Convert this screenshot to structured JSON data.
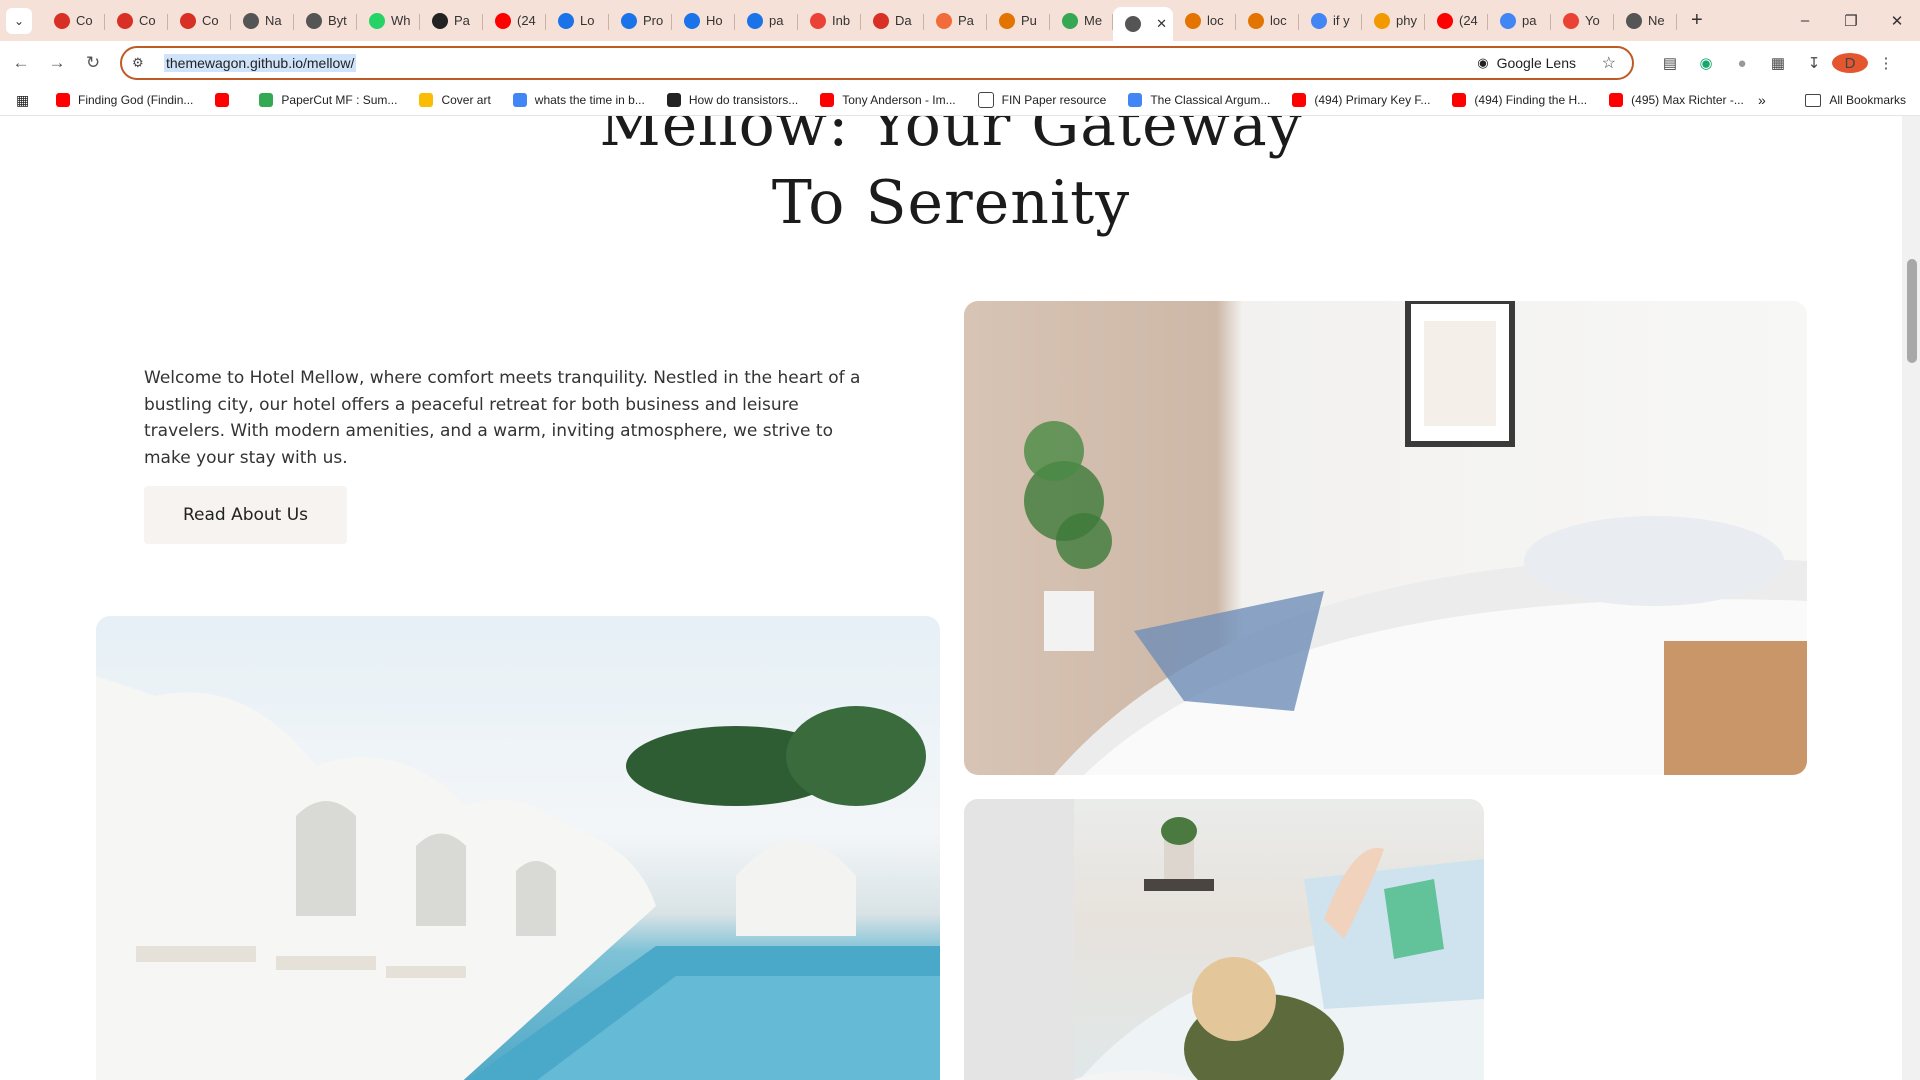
{
  "browser": {
    "tabs": [
      {
        "label": "Co",
        "icon": "loading-ring-icon",
        "color": "#d93025"
      },
      {
        "label": "Co",
        "icon": "loading-ring-icon",
        "color": "#d93025"
      },
      {
        "label": "Co",
        "icon": "loading-ring-icon",
        "color": "#d93025"
      },
      {
        "label": "Na",
        "icon": "globe-icon",
        "color": "#555555"
      },
      {
        "label": "Byt",
        "icon": "globe-icon",
        "color": "#555555"
      },
      {
        "label": "Wh",
        "icon": "whatsapp-icon",
        "color": "#25d366"
      },
      {
        "label": "Pa",
        "icon": "github-icon",
        "color": "#222222"
      },
      {
        "label": "(24",
        "icon": "youtube-icon",
        "color": "#ff0000"
      },
      {
        "label": "Lo",
        "icon": "docs-icon",
        "color": "#1a73e8"
      },
      {
        "label": "Pro",
        "icon": "docs-icon",
        "color": "#1a73e8"
      },
      {
        "label": "Ho",
        "icon": "docs-icon",
        "color": "#1a73e8"
      },
      {
        "label": "pa",
        "icon": "docs-icon",
        "color": "#1a73e8"
      },
      {
        "label": "Inb",
        "icon": "gmail-icon",
        "color": "#ea4335"
      },
      {
        "label": "Da",
        "icon": "loading-ring-icon",
        "color": "#d93025"
      },
      {
        "label": "Pa",
        "icon": "pay-icon",
        "color": "#f26b3a"
      },
      {
        "label": "Pu",
        "icon": "pub-icon",
        "color": "#e37400"
      },
      {
        "label": "Me",
        "icon": "leaf-icon",
        "color": "#34a853"
      },
      {
        "label": "",
        "icon": "globe-icon",
        "color": "#555555",
        "active": true
      },
      {
        "label": "loc",
        "icon": "chart-icon",
        "color": "#e37400"
      },
      {
        "label": "loc",
        "icon": "chart-icon",
        "color": "#e37400"
      },
      {
        "label": "if y",
        "icon": "google-icon",
        "color": "#4285f4"
      },
      {
        "label": "phy",
        "icon": "sheet-icon",
        "color": "#f29900"
      },
      {
        "label": "(24",
        "icon": "youtube-icon",
        "color": "#ff0000"
      },
      {
        "label": "pa",
        "icon": "google-icon",
        "color": "#4285f4"
      },
      {
        "label": "Yo",
        "icon": "gmail-icon",
        "color": "#ea4335"
      },
      {
        "label": "Ne",
        "icon": "globe-icon",
        "color": "#555555"
      }
    ],
    "url": "themewagon.github.io/mellow/",
    "google_lens_label": "Google Lens",
    "avatar_letter": "D",
    "bookmarks": [
      {
        "label": "Finding God (Findin...",
        "color": "#ff0000"
      },
      {
        "label": "",
        "color": "#ff0000"
      },
      {
        "label": "PaperCut MF : Sum...",
        "color": "#34a853"
      },
      {
        "label": "Cover art",
        "color": "#fbbc04"
      },
      {
        "label": "whats the time in b...",
        "color": "#4285f4"
      },
      {
        "label": "How do transistors...",
        "color": "#222222"
      },
      {
        "label": "Tony Anderson - Im...",
        "color": "#ff0000"
      },
      {
        "label": "FIN Paper resource",
        "color": "#ffffff"
      },
      {
        "label": "The Classical Argum...",
        "color": "#4285f4"
      },
      {
        "label": "(494) Primary Key F...",
        "color": "#ff0000"
      },
      {
        "label": "(494) Finding the H...",
        "color": "#ff0000"
      },
      {
        "label": "(495) Max Richter -...",
        "color": "#ff0000"
      }
    ],
    "all_bookmarks_label": "All Bookmarks"
  },
  "page": {
    "hero_title_line1": "Mellow: Your Gateway",
    "hero_title_line2": "To Serenity",
    "intro_text": "Welcome to Hotel Mellow, where comfort meets tranquility. Nestled in the heart of a bustling city, our hotel offers a peaceful retreat for both business and leisure travelers. With modern amenities, and a warm, inviting atmosphere, we strive to make your stay with us.",
    "cta_label": "Read About Us"
  },
  "colors": {
    "tabstrip": "#f6e1d8",
    "omnibox_border": "#bf5a24",
    "button_bg": "#f6f3f1"
  }
}
